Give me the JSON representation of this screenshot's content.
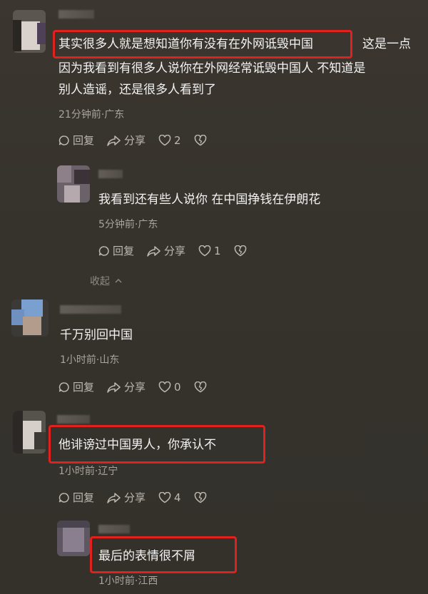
{
  "colors": {
    "background": "#37332d",
    "highlight": "#e0211d",
    "meta": "#a9a49c"
  },
  "comments": [
    {
      "text_lines": [
        "其实很多人就是想知道你有没有在外网诋毁中国",
        "这是一点",
        "因为我看到有很多人说你在外网经常诋毁中国人   不知道是",
        "别人造谣，还是很多人看到了"
      ],
      "meta": "21分钟前·广东",
      "reply": "回复",
      "share": "分享",
      "likes": "2"
    },
    {
      "text_lines": [
        "我看到还有些人说你   在中国挣钱在伊朗花"
      ],
      "meta": "5分钟前·广东",
      "reply": "回复",
      "share": "分享",
      "likes": "1",
      "collapse": "收起"
    },
    {
      "text_lines": [
        "千万别回中国"
      ],
      "meta": "1小时前·山东",
      "reply": "回复",
      "share": "分享",
      "likes": "0"
    },
    {
      "text_lines": [
        "他诽谤过中国男人，你承认不"
      ],
      "meta": "1小时前·辽宁",
      "reply": "回复",
      "share": "分享",
      "likes": "4"
    },
    {
      "text_lines": [
        "最后的表情很不屑"
      ],
      "meta": "1小时前·江西"
    }
  ]
}
